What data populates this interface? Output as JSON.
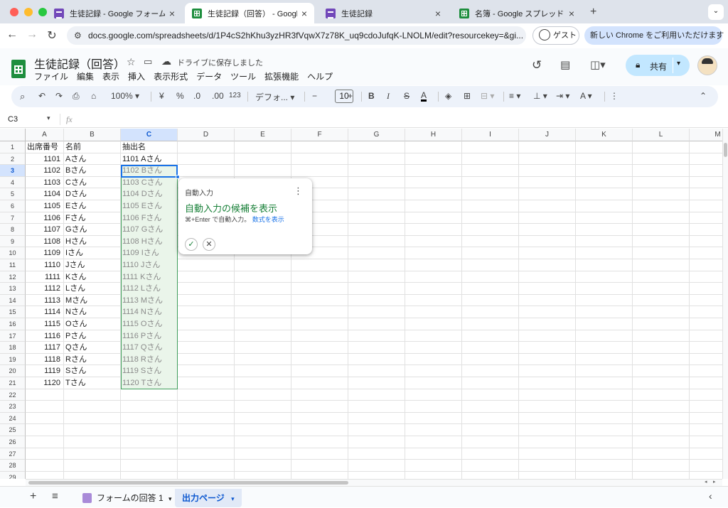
{
  "browser": {
    "tabs": [
      {
        "title": "生徒記録 - Google フォーム",
        "icon": "forms-icon",
        "active": false
      },
      {
        "title": "生徒記録（回答） - Google スプレ",
        "icon": "sheets-icon",
        "active": true
      },
      {
        "title": "生徒記録",
        "icon": "forms-icon",
        "active": false
      },
      {
        "title": "名簿 - Google スプレッドシート",
        "icon": "sheets-icon",
        "active": false
      }
    ],
    "url": "docs.google.com/spreadsheets/d/1P4cS2hKhu3yzHR3fVqwX7z78K_uq9cdoJufqK-LNOLM/edit?resourcekey=&gi...",
    "guest_label": "ゲスト",
    "chrome_button": "新しい Chrome をご利用いただけます"
  },
  "doc": {
    "title": "生徒記録（回答）",
    "save_status": "ドライブに保存しました",
    "menu": [
      "ファイル",
      "編集",
      "表示",
      "挿入",
      "表示形式",
      "データ",
      "ツール",
      "拡張機能",
      "ヘルプ"
    ],
    "share_label": "共有"
  },
  "toolbar": {
    "zoom": "100%",
    "currency": "¥",
    "percent": "%",
    "dec_less": ".0",
    "dec_more": ".00",
    "num_format": "123",
    "font": "デフォ...",
    "font_size": "10",
    "bold": "B",
    "italic": "I",
    "strike": "S",
    "text_color": "A"
  },
  "formula_bar": {
    "name_box": "C3",
    "fx": "fx"
  },
  "sheet": {
    "columns": [
      "A",
      "B",
      "C",
      "D",
      "E",
      "F",
      "G",
      "H",
      "I",
      "J",
      "K",
      "L",
      "M"
    ],
    "selected_column": "C",
    "rows": [
      "1",
      "2",
      "3",
      "4",
      "5",
      "6",
      "7",
      "8",
      "9",
      "10",
      "11",
      "12",
      "13",
      "14",
      "15",
      "16",
      "17",
      "18",
      "19",
      "20",
      "21",
      "22",
      "23",
      "24",
      "25",
      "26",
      "27",
      "28",
      "29"
    ],
    "selected_row": "3",
    "header_row": [
      "出席番号",
      "名前",
      "抽出名"
    ],
    "data": [
      [
        "1101",
        "Aさん",
        "1101 Aさん"
      ],
      [
        "1102",
        "Bさん",
        "1102 Bさん"
      ],
      [
        "1103",
        "Cさん",
        "1103 Cさん"
      ],
      [
        "1104",
        "Dさん",
        "1104 Dさん"
      ],
      [
        "1105",
        "Eさん",
        "1105 Eさん"
      ],
      [
        "1106",
        "Fさん",
        "1106 Fさん"
      ],
      [
        "1107",
        "Gさん",
        "1107 Gさん"
      ],
      [
        "1108",
        "Hさん",
        "1108 Hさん"
      ],
      [
        "1109",
        "Iさん",
        "1109 Iさん"
      ],
      [
        "1110",
        "Jさん",
        "1110 Jさん"
      ],
      [
        "1111",
        "Kさん",
        "1111 Kさん"
      ],
      [
        "1112",
        "Lさん",
        "1112 Lさん"
      ],
      [
        "1113",
        "Mさん",
        "1113 Mさん"
      ],
      [
        "1114",
        "Nさん",
        "1114 Nさん"
      ],
      [
        "1115",
        "Oさん",
        "1115 Oさん"
      ],
      [
        "1116",
        "Pさん",
        "1116 Pさん"
      ],
      [
        "1117",
        "Qさん",
        "1117 Qさん"
      ],
      [
        "1118",
        "Rさん",
        "1118 Rさん"
      ],
      [
        "1119",
        "Sさん",
        "1119 Sさん"
      ],
      [
        "1120",
        "Tさん",
        "1120 Tさん"
      ]
    ]
  },
  "autofill_popup": {
    "title": "自動入力",
    "heading": "自動入力の候補を表示",
    "hint": "⌘+Enter で自動入力。",
    "link": "数式を表示"
  },
  "sheet_tabs": {
    "tabs": [
      "フォームの回答 1",
      "出力ページ"
    ],
    "active": "出力ページ"
  },
  "colors": {
    "accent": "#1a73e8",
    "suggest_green": "#188038",
    "share_bg": "#c2e7ff"
  }
}
